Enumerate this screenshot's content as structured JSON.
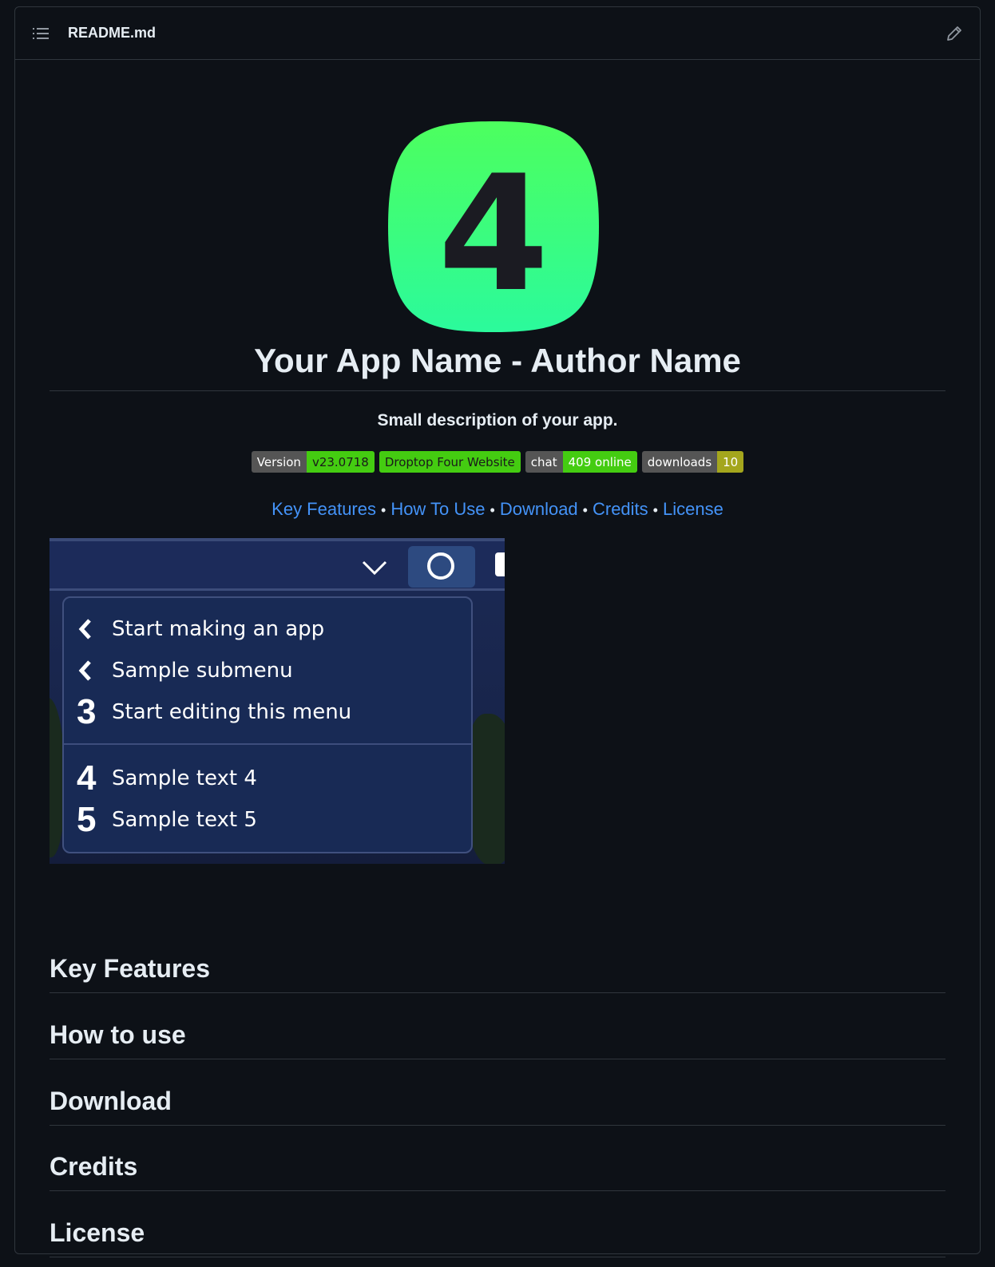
{
  "file_header": {
    "toc_icon": "list-unordered-icon",
    "file_name": "README.md",
    "edit_icon": "pencil-icon"
  },
  "readme": {
    "logo": {
      "glyph": "4",
      "icon": "app-logo-icon",
      "color_top": "#4dff5e",
      "color_bottom": "#2bfa9c"
    },
    "title": "Your App Name - Author Name",
    "description": "Small description of your app.",
    "badges": [
      {
        "label": "Version",
        "value": "v23.0718",
        "value_color": "#4c1",
        "value_text_color": "#1a1a1a"
      },
      {
        "label": "",
        "value": "Droptop Four Website",
        "value_color": "#4c1",
        "value_text_color": "#1a1a1a"
      },
      {
        "label": "chat",
        "value": "409 online",
        "value_color": "#44cc11",
        "value_text_color": "#ffffff"
      },
      {
        "label": "downloads",
        "value": "10",
        "value_color": "#a4a61d",
        "value_text_color": "#ffffff"
      }
    ],
    "nav_links": [
      "Key Features",
      "How To Use",
      "Download",
      "Credits",
      "License"
    ],
    "nav_separator": "•",
    "screenshot": {
      "menu_items": [
        {
          "glyph": "chevron-left-icon",
          "label": "Start making an app"
        },
        {
          "glyph": "chevron-left-icon",
          "label": "Sample submenu"
        },
        {
          "glyph": "3",
          "label": "Start editing this menu"
        },
        {
          "glyph": "4",
          "label": "Sample text 4"
        },
        {
          "glyph": "5",
          "label": "Sample text 5"
        }
      ]
    },
    "sections": [
      "Key Features",
      "How to use",
      "Download",
      "Credits",
      "License"
    ]
  }
}
